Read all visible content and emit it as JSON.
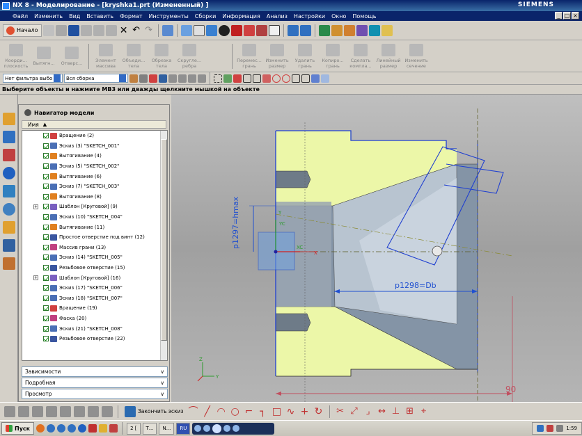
{
  "window": {
    "title": "NX 8 - Моделирование - [kryshka1.prt (Измененный) ]",
    "brand": "SIEMENS"
  },
  "menu": [
    "Файл",
    "Изменить",
    "Вид",
    "Вставить",
    "Формат",
    "Инструменты",
    "Сборки",
    "Информация",
    "Анализ",
    "Настройки",
    "Окно",
    "Помощь"
  ],
  "toolbar1": {
    "start_label": "Начало"
  },
  "toolbar2": {
    "items": [
      {
        "label1": "Коорди...",
        "label2": "плоскость"
      },
      {
        "label1": "Вытягн...",
        "label2": ""
      },
      {
        "label1": "Отверс...",
        "label2": ""
      },
      {
        "label1": "Элемент",
        "label2": "массива"
      },
      {
        "label1": "Объеди...",
        "label2": "тела"
      },
      {
        "label1": "Обрезка",
        "label2": "тела"
      },
      {
        "label1": "Скругле...",
        "label2": "ребра"
      },
      {
        "label1": "Перемес...",
        "label2": "грань"
      },
      {
        "label1": "Изменить",
        "label2": "размер"
      },
      {
        "label1": "Удалить",
        "label2": "грань"
      },
      {
        "label1": "Копиро...",
        "label2": "грань"
      },
      {
        "label1": "Сделать",
        "label2": "компла..."
      },
      {
        "label1": "Линейный",
        "label2": "размер"
      },
      {
        "label1": "Изменить",
        "label2": "сечение"
      }
    ]
  },
  "selection": {
    "filter": "Нет фильтра выбо",
    "scope": "Вся сборка"
  },
  "cue": "Выберите объекты и нажмите МВ3 или дважды щелкните мышкой на объекте",
  "navigator": {
    "title": "Навигатор модели",
    "column": "Имя",
    "items": [
      {
        "label": "Вращение (2)",
        "color": "#d04040"
      },
      {
        "label": "Эскиз (3) \"SKETCH_001\"",
        "color": "#4a6fb5"
      },
      {
        "label": "Вытягивание (4)",
        "color": "#e08020"
      },
      {
        "label": "Эскиз (5) \"SKETCH_002\"",
        "color": "#4a6fb5"
      },
      {
        "label": "Вытягивание (6)",
        "color": "#e08020"
      },
      {
        "label": "Эскиз (7) \"SKETCH_003\"",
        "color": "#4a6fb5"
      },
      {
        "label": "Вытягивание (8)",
        "color": "#e08020"
      },
      {
        "label": "Шаблон [Круговой] (9)",
        "color": "#7a5fc0",
        "expand": true
      },
      {
        "label": "Эскиз (10) \"SKETCH_004\"",
        "color": "#4a6fb5"
      },
      {
        "label": "Вытягивание (11)",
        "color": "#e08020"
      },
      {
        "label": "Простое отверстие под винт (12)",
        "color": "#3a56a0"
      },
      {
        "label": "Массив грани (13)",
        "color": "#c04080"
      },
      {
        "label": "Эскиз (14) \"SKETCH_005\"",
        "color": "#4a6fb5"
      },
      {
        "label": "Резьбовое отверстие (15)",
        "color": "#3a56a0"
      },
      {
        "label": "Шаблон [Круговой] (16)",
        "color": "#7a5fc0",
        "expand": true
      },
      {
        "label": "Эскиз (17) \"SKETCH_006\"",
        "color": "#4a6fb5"
      },
      {
        "label": "Эскиз (18) \"SKETCH_007\"",
        "color": "#4a6fb5"
      },
      {
        "label": "Вращение (19)",
        "color": "#d04040"
      },
      {
        "label": "Фаска (20)",
        "color": "#c04080"
      },
      {
        "label": "Эскиз (21) \"SKETCH_008\"",
        "color": "#4a6fb5"
      },
      {
        "label": "Резьбовое отверстие (22)",
        "color": "#3a56a0"
      }
    ],
    "panels": [
      "Зависимости",
      "Подробная",
      "Просмотр"
    ]
  },
  "viewport": {
    "dim_hmax": "p1297=hmax",
    "dim_db": "p1298=Db",
    "dim_90": "90",
    "axis_xc": "XC",
    "axis_yc": "YC",
    "axis_x": "X",
    "axis_y": "Y",
    "triad_z": "Z",
    "triad_y": "Y"
  },
  "bottom": {
    "finish_sketch": "Закончить эскиз"
  },
  "taskbar": {
    "start": "Пуск",
    "tasks": [
      "2 [",
      "Т...",
      "N..."
    ],
    "lang": "RU",
    "clock": "1:59"
  }
}
